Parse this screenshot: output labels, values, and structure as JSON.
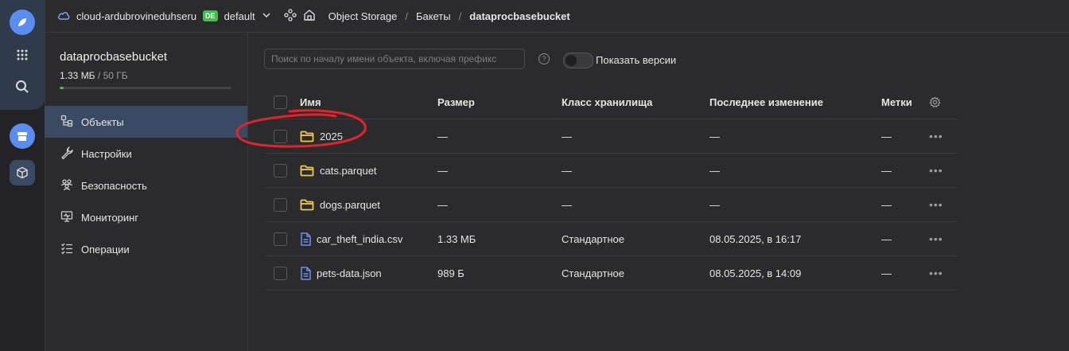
{
  "topbar": {
    "cloud_name": "cloud-ardubrovineduhseru",
    "folder_badge": "DE",
    "folder_name": "default",
    "breadcrumbs": [
      "Object Storage",
      "Бакеты",
      "dataprocbasebucket"
    ],
    "separator": "/"
  },
  "sidebar": {
    "bucket_name": "dataprocbasebucket",
    "usage": "1.33 МБ",
    "usage_limit": "/ 50 ГБ",
    "usage_fraction": 3e-05,
    "items": [
      {
        "label": "Объекты",
        "icon": "objects-icon",
        "active": true
      },
      {
        "label": "Настройки",
        "icon": "wrench-icon",
        "active": false
      },
      {
        "label": "Безопасность",
        "icon": "users-icon",
        "active": false
      },
      {
        "label": "Мониторинг",
        "icon": "monitor-icon",
        "active": false
      },
      {
        "label": "Операции",
        "icon": "list-icon",
        "active": false
      }
    ]
  },
  "toolbar": {
    "search_placeholder": "Поиск по началу имени объекта, включая префикс",
    "help": "?",
    "show_versions_label": "Показать версии",
    "show_versions_on": false
  },
  "table": {
    "headers": {
      "name": "Имя",
      "size": "Размер",
      "class": "Класс хранилища",
      "modified": "Последнее изменение",
      "tags": "Метки"
    },
    "rows": [
      {
        "type": "folder",
        "name": "2025",
        "size": "—",
        "class": "—",
        "modified": "—",
        "tags": "—",
        "actions": "•••"
      },
      {
        "type": "folder",
        "name": "cats.parquet",
        "size": "—",
        "class": "—",
        "modified": "—",
        "tags": "—",
        "actions": "•••"
      },
      {
        "type": "folder",
        "name": "dogs.parquet",
        "size": "—",
        "class": "—",
        "modified": "—",
        "tags": "—",
        "actions": "•••"
      },
      {
        "type": "file",
        "name": "car_theft_india.csv",
        "size": "1.33 МБ",
        "class": "Стандартное",
        "modified": "08.05.2025, в 16:17",
        "tags": "—",
        "actions": "•••"
      },
      {
        "type": "file",
        "name": "pets-data.json",
        "size": "989 Б",
        "class": "Стандартное",
        "modified": "08.05.2025, в 14:09",
        "tags": "—",
        "actions": "•••"
      }
    ]
  },
  "colors": {
    "folder": "#f2c94c",
    "file": "#6e8ef0",
    "accent": "#3dc04a",
    "annotation": "#e0242b"
  }
}
